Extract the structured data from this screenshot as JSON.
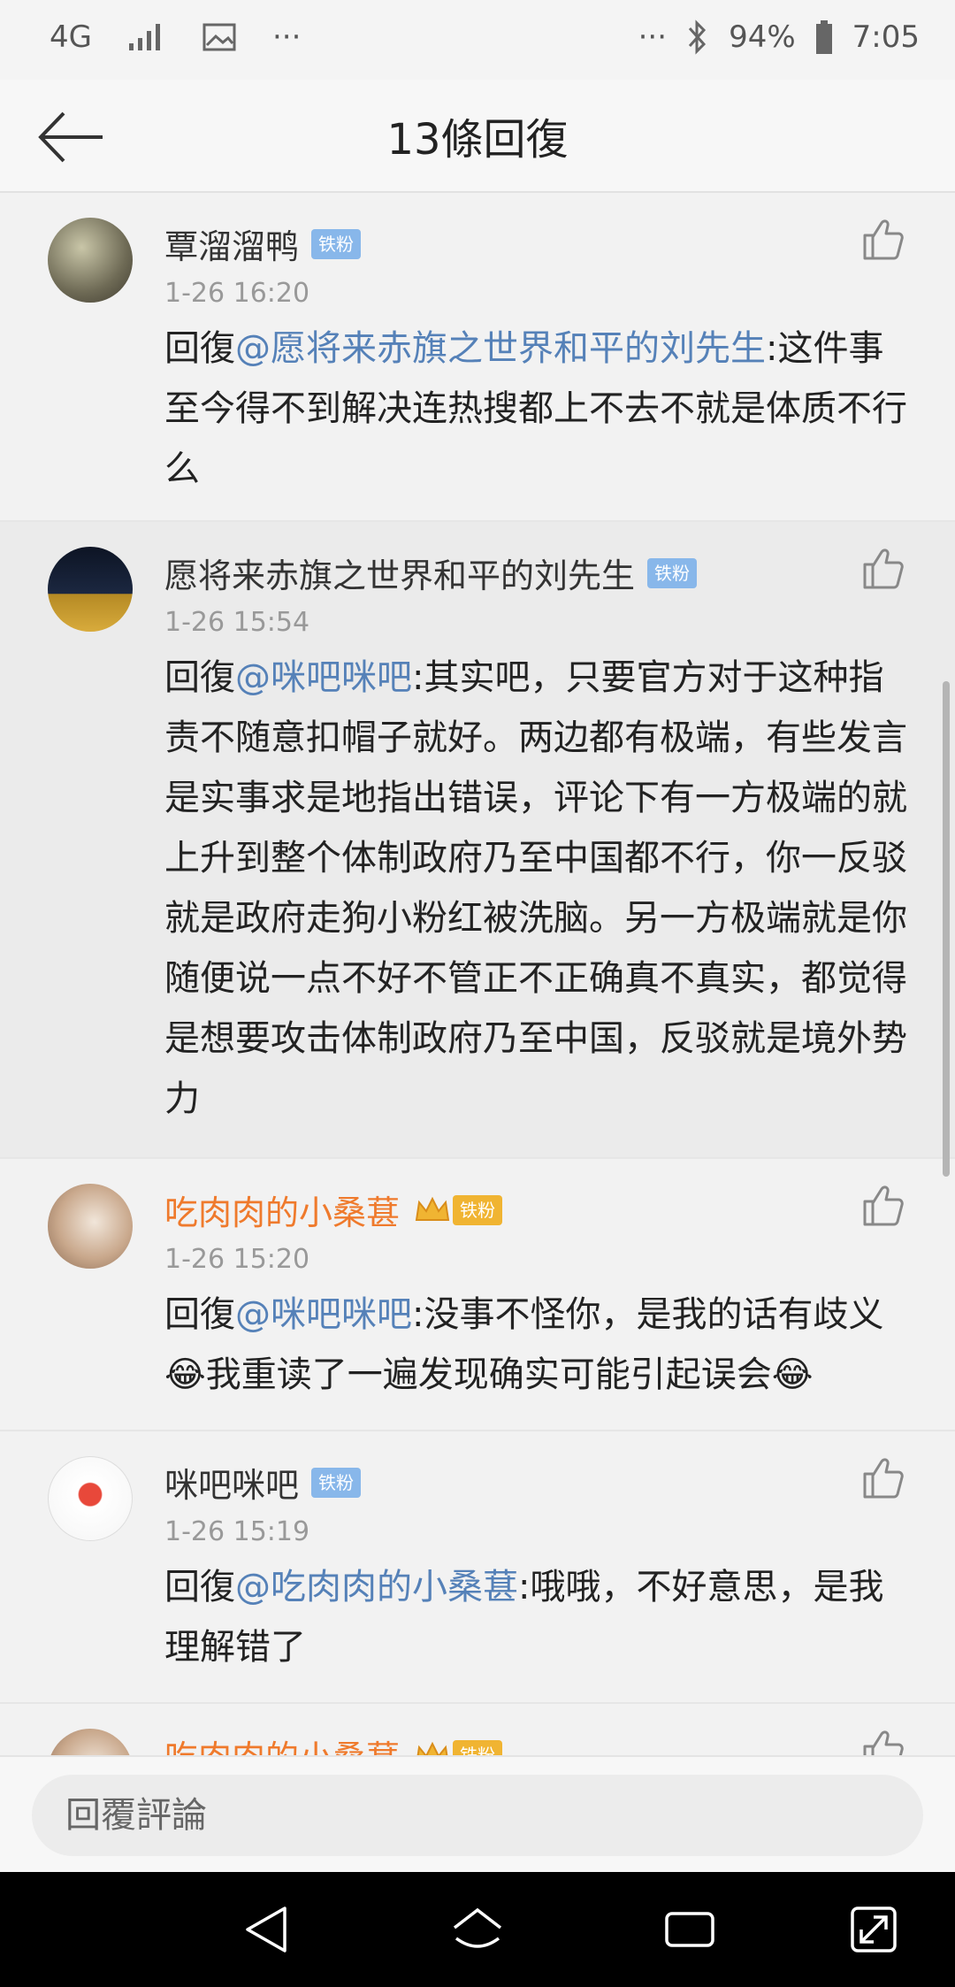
{
  "status_bar": {
    "network": "4G",
    "battery": "94%",
    "time": "7:05",
    "dots_left": "···",
    "dots_right": "···"
  },
  "header": {
    "title": "13條回復"
  },
  "comments": [
    {
      "name": "覃溜溜鸭",
      "badge": "铁粉",
      "time": "1-26 16:20",
      "prefix": "回復",
      "mention": "@愿将来赤旗之世界和平的刘先生",
      "body": ":这件事至今得不到解决连热搜都上不去不就是体质不行么"
    },
    {
      "name": "愿将来赤旗之世界和平的刘先生",
      "badge": "铁粉",
      "time": "1-26 15:54",
      "prefix": "回復",
      "mention": "@咪吧咪吧",
      "body": ":其实吧，只要官方对于这种指责不随意扣帽子就好。两边都有极端，有些发言是实事求是地指出错误，评论下有一方极端的就上升到整个体制政府乃至中国都不行，你一反驳就是政府走狗小粉红被洗脑。另一方极端就是你随便说一点不好不管正不正确真不真实，都觉得是想要攻击体制政府乃至中国，反驳就是境外势力"
    },
    {
      "name": "吃肉肉的小桑葚",
      "badge": "铁粉",
      "time": "1-26 15:20",
      "prefix": "回復",
      "mention": "@咪吧咪吧",
      "body": ":没事不怪你，是我的话有歧义😂我重读了一遍发现确实可能引起误会😂"
    },
    {
      "name": "咪吧咪吧",
      "badge": "铁粉",
      "time": "1-26 15:19",
      "prefix": "回復",
      "mention": "@吃肉肉的小桑葚",
      "body": ":哦哦，不好意思，是我理解错了"
    },
    {
      "name": "吃肉肉的小桑葚",
      "badge": "铁粉"
    }
  ],
  "reply_box": {
    "placeholder": "回覆評論"
  },
  "colors": {
    "mention": "#5581b8",
    "vip_name": "#ef7a2c",
    "fan_badge": "#88b7ea"
  }
}
